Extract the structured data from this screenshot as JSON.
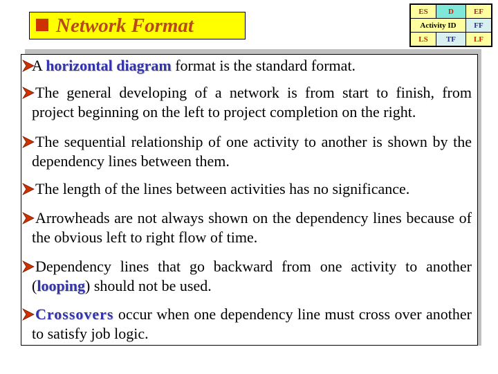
{
  "title": {
    "text": "Network Format",
    "bullet_color": "#cc3300",
    "background": "#ffff00"
  },
  "activity_node": {
    "rows": [
      [
        "ES",
        "D",
        "EF"
      ],
      [
        "Activity ID",
        "FF"
      ],
      [
        "LS",
        "TF",
        "LF"
      ]
    ]
  },
  "bullets": [
    {
      "pre": "A ",
      "highlight": "horizontal diagram",
      "post": " format is the standard format."
    },
    {
      "text": "The general developing of a network is from start to finish, from project beginning on the left to project completion on the right."
    },
    {
      "text": "The sequential relationship of one activity to another is shown by the dependency lines between them."
    },
    {
      "text": "The length of the lines between activities has no significance."
    },
    {
      "text": "Arrowheads are not always shown on the dependency lines because of the obvious left to right flow of time."
    },
    {
      "pre": "Dependency lines that go backward from one activity to another (",
      "highlight": "looping",
      "post": ") should not be used."
    },
    {
      "pre": "",
      "highlight": "Crossovers",
      "post": " occur when one dependency line must cross over another to satisfy job logic."
    }
  ],
  "colors": {
    "highlight": "#3333aa",
    "arrow": "#cc3300"
  }
}
